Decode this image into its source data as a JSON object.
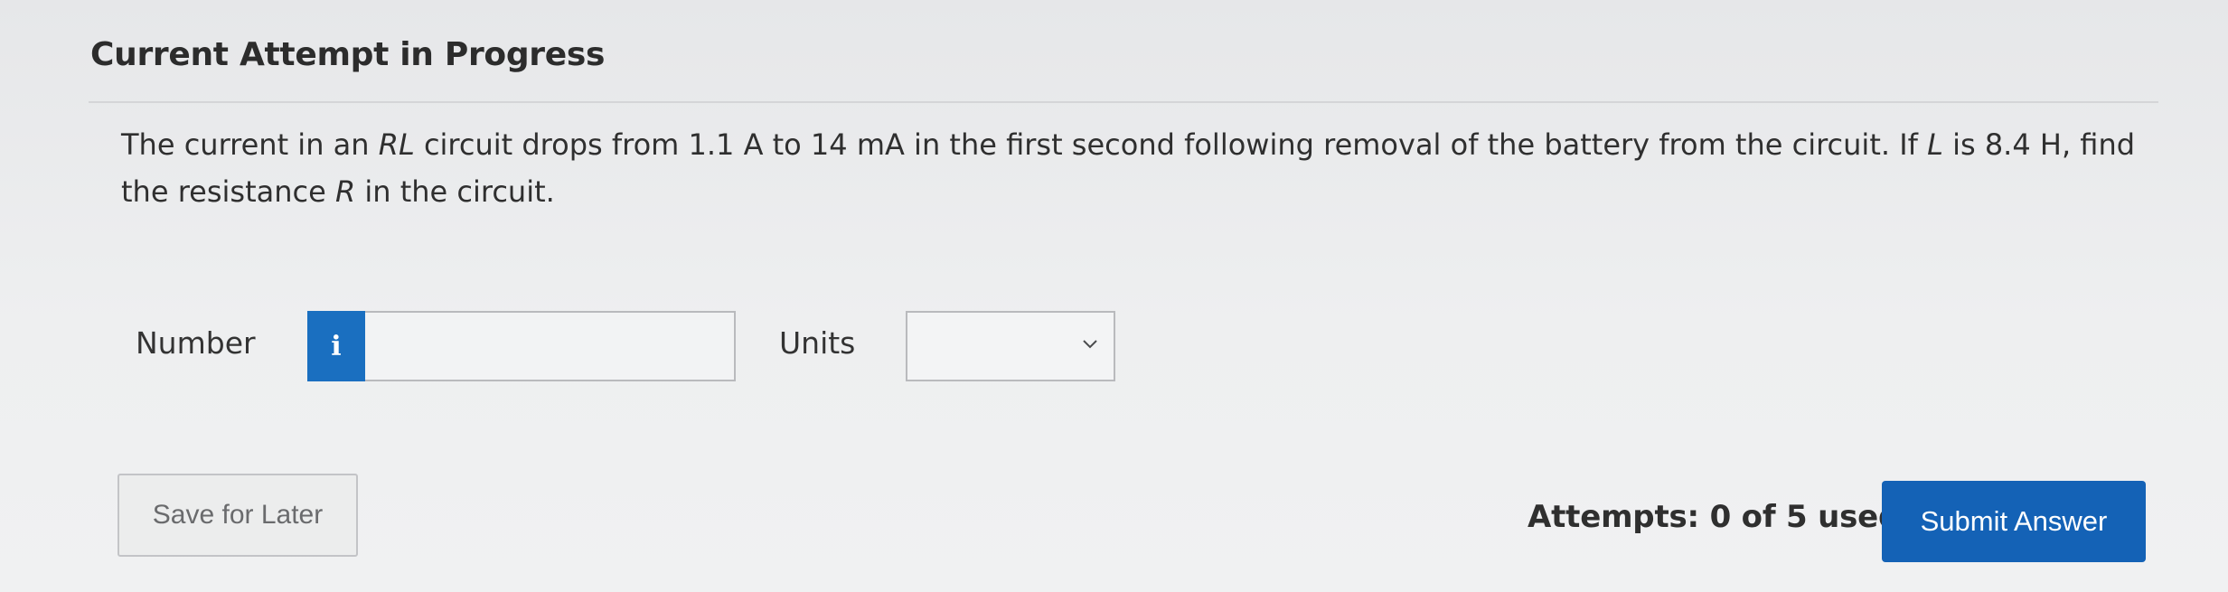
{
  "header": {
    "title": "Current Attempt in Progress"
  },
  "question": {
    "text_1": "The current in an ",
    "var_RL": "RL",
    "text_2": " circuit drops from 1.1 A to 14 mA in the first second following removal of the battery from the circuit. If ",
    "var_L": "L",
    "text_3": " is 8.4 H, find the resistance ",
    "var_R": "R",
    "text_4": " in the circuit."
  },
  "answer": {
    "number_label": "Number",
    "info_icon_glyph": "i",
    "number_value": "",
    "units_label": "Units",
    "units_selected": ""
  },
  "footer": {
    "save_label": "Save for Later",
    "attempts_text": "Attempts: 0 of 5 used",
    "submit_label": "Submit Answer"
  },
  "colors": {
    "accent": "#1462b6",
    "info_button": "#1a6fc0"
  }
}
